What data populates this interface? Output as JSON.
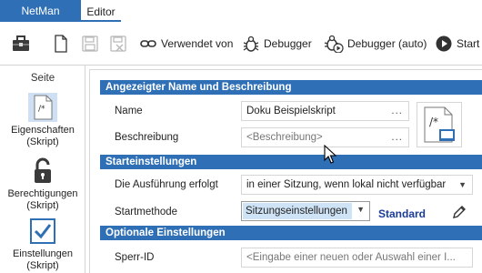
{
  "tabs": {
    "app": "NetMan",
    "editor": "Editor"
  },
  "toolbar": {
    "used_by": "Verwendet von",
    "debugger": "Debugger",
    "debugger_auto": "Debugger (auto)",
    "start": "Start"
  },
  "sidebar": {
    "title": "Seite",
    "items": [
      {
        "label": "Eigenschaften\n(Skript)",
        "line1": "Eigenschaften",
        "line2": "(Skript)"
      },
      {
        "label": "Berechtigungen\n(Skript)",
        "line1": "Berechtigungen",
        "line2": "(Skript)"
      },
      {
        "label": "Einstellungen\n(Skript)",
        "line1": "Einstellungen",
        "line2": "(Skript)"
      }
    ]
  },
  "sections": {
    "name_desc": {
      "header": "Angezeigter Name und Beschreibung",
      "name_label": "Name",
      "name_value": "Doku Beispielskript",
      "desc_label": "Beschreibung",
      "desc_placeholder": "<Beschreibung>"
    },
    "start": {
      "header": "Starteinstellungen",
      "exec_label": "Die Ausführung erfolgt",
      "exec_value": "in einer Sitzung, wenn lokal nicht verfügbar",
      "method_label": "Startmethode",
      "method_value": "Sitzungseinstellungen",
      "standard_link": "Standard"
    },
    "optional": {
      "header": "Optionale Einstellungen",
      "lock_label": "Sperr-ID",
      "lock_placeholder": "<Eingabe einer neuen oder Auswahl einer I..."
    }
  },
  "field_dots": "...",
  "colors": {
    "accent": "#2f6fb5",
    "link": "#1b3d9a",
    "selection": "#cfe3f7"
  }
}
